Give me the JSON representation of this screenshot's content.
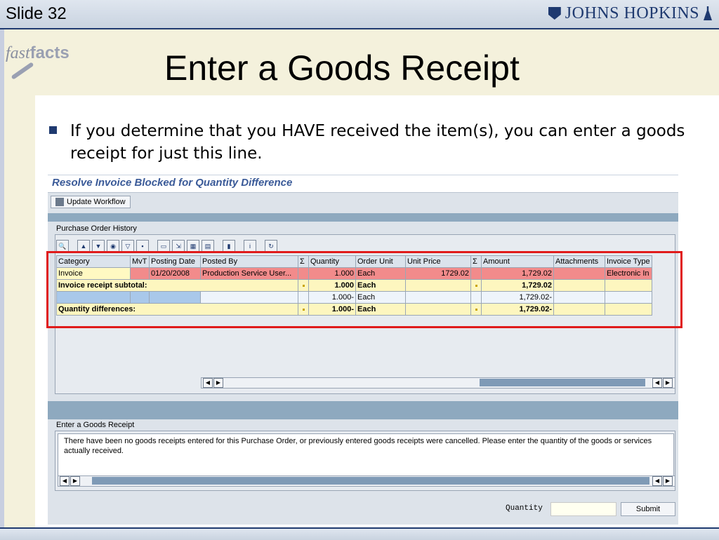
{
  "slide": {
    "number_label": "Slide 32",
    "logo_text": "JOHNS HOPKINS",
    "brand_small": "fast",
    "brand_big": "facts"
  },
  "title": "Enter a Goods Receipt",
  "bullet": "If you determine that you HAVE received the item(s), you can enter a goods receipt for just this line.",
  "sap": {
    "screen_title": "Resolve Invoice Blocked for Quantity Difference",
    "update_workflow_label": "Update Workflow",
    "po_history_label": "Purchase Order History",
    "columns": [
      "Category",
      "MvT",
      "Posting Date",
      "Posted By",
      "Σ",
      "Quantity",
      "Order Unit",
      "Unit Price",
      "Σ",
      "Amount",
      "Attachments",
      "Invoice Type"
    ],
    "rows": {
      "invoice": {
        "category": "Invoice",
        "mvt": "",
        "posting_date": "01/20/2008",
        "posted_by": "Production Service User...",
        "quantity": "1.000",
        "order_unit": "Each",
        "unit_price": "1729.02",
        "amount": "1,729.02",
        "attachments": "",
        "invoice_type": "Electronic In"
      },
      "invoice_subtotal": {
        "label": "Invoice receipt subtotal:",
        "quantity": "1.000",
        "order_unit": "Each",
        "amount": "1,729.02"
      },
      "blank_row": {
        "quantity": "1.000-",
        "order_unit": "Each",
        "amount": "1,729.02-"
      },
      "qty_diff": {
        "label": "Quantity differences:",
        "quantity": "1.000-",
        "order_unit": "Each",
        "amount": "1,729.02-"
      }
    },
    "enter_gr_label": "Enter a Goods Receipt",
    "gr_message": "There have been no goods receipts entered for this Purchase Order, or previously entered goods receipts were cancelled. Please enter the quantity of the goods or services actually received.",
    "quantity_label": "Quantity",
    "quantity_value": "",
    "submit_label": "Submit"
  }
}
